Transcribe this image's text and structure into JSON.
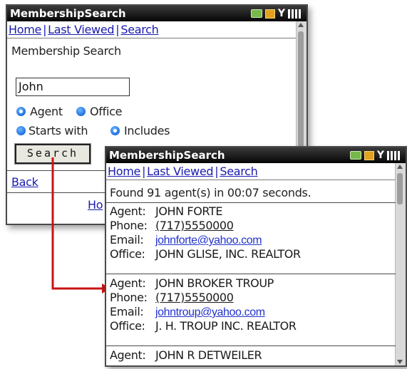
{
  "back_window": {
    "title": "MembershipSearch",
    "nav": {
      "home": "Home",
      "last_viewed": "Last Viewed",
      "search": "Search",
      "sep": "|"
    },
    "heading": "Membership Search",
    "search_value": "John",
    "radio_agent": "Agent",
    "radio_office": "Office",
    "radio_starts": "Starts with",
    "radio_includes": "Includes",
    "search_button": "Search",
    "back_link": "Back",
    "home_link_partial": "Ho"
  },
  "front_window": {
    "title": "MembershipSearch",
    "nav": {
      "home": "Home",
      "last_viewed": "Last Viewed",
      "search": "Search",
      "sep": "|"
    },
    "found_text": "Found 91 agent(s) in 00:07 seconds.",
    "records": [
      {
        "agent_label": "Agent:",
        "agent": "JOHN FORTE",
        "phone_label": "Phone:",
        "phone": "(717)5550000",
        "email_label": "Email:",
        "email": "johnforte@yahoo.com",
        "office_label": "Office:",
        "office": "JOHN GLISE, INC. REALTOR"
      },
      {
        "agent_label": "Agent:",
        "agent": "JOHN BROKER TROUP",
        "phone_label": "Phone:",
        "phone": "(717)5550000",
        "email_label": "Email:",
        "email": "johntroup@yahoo.com",
        "office_label": "Office:",
        "office": "J. H. TROUP INC. REALTOR"
      },
      {
        "agent_label": "Agent:",
        "agent": "JOHN R DETWEILER"
      }
    ]
  },
  "colors": {
    "arrow": "#c81414",
    "link": "#1a1ab0",
    "radio": "#1f6ee0"
  }
}
